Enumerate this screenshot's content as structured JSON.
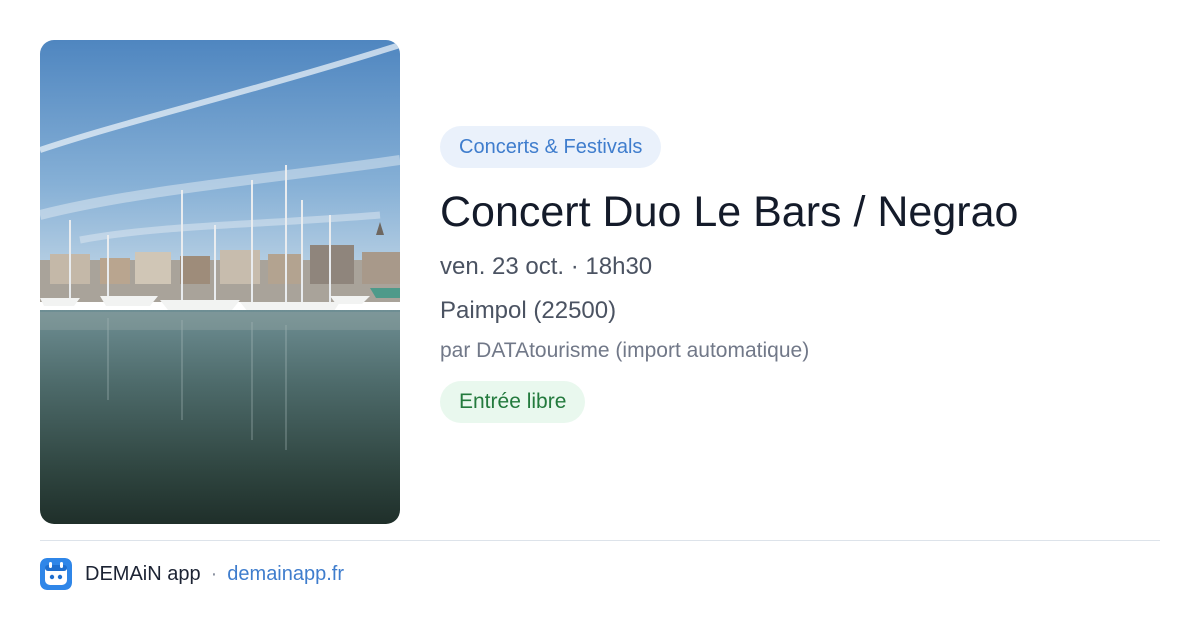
{
  "event": {
    "category": "Concerts & Festivals",
    "title": "Concert Duo Le Bars / Negrao",
    "datetime": "ven. 23 oct. · 18h30",
    "place": "Paimpol (22500)",
    "source": "par DATAtourisme (import automatique)",
    "price": "Entrée libre"
  },
  "footer": {
    "app_name": "DEMAiN app",
    "separator": "·",
    "site": "demainapp.fr"
  },
  "colors": {
    "category_text": "#3f7dcd",
    "category_bg": "#eaf1fb",
    "price_text": "#237a3d",
    "price_bg": "#e9f8ee",
    "link": "#3f7dcd",
    "app_icon_bg": "#2f86e8"
  },
  "icons": {
    "app": "demain-app-icon"
  }
}
